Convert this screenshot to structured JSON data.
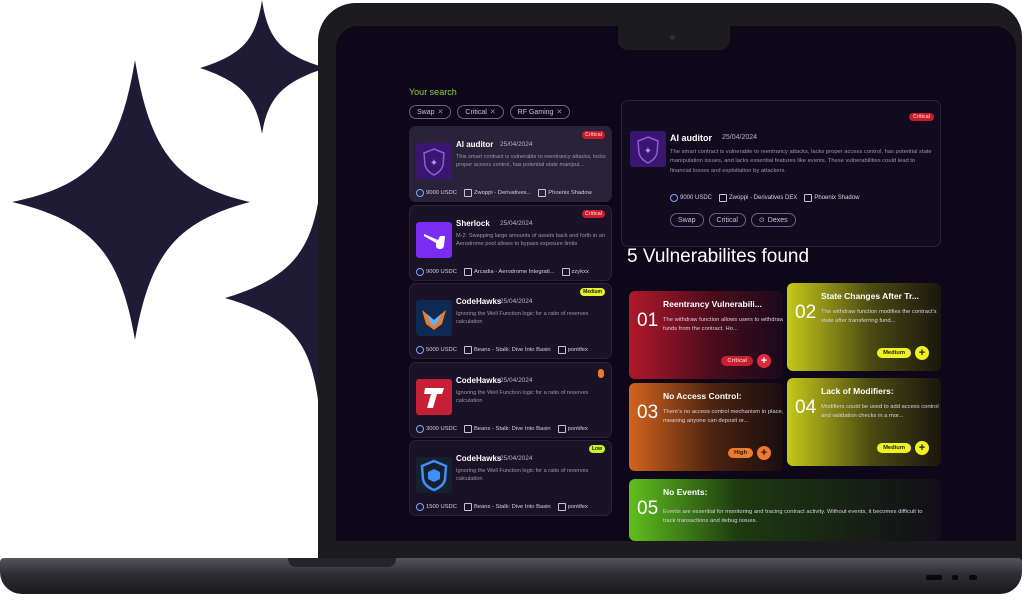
{
  "search": {
    "label": "Your search",
    "chips": [
      "Swap",
      "Critical",
      "RF Gaming"
    ]
  },
  "results": [
    {
      "title": "AI auditor",
      "date": "25/04/2024",
      "description": "This smart contract is vulnerable to reentrancy attacks, locks proper access control, has potential state manipul...",
      "amount": "9000 USDC",
      "project": "Zwoppi - Derivatives...",
      "auditor": "Phoenix Shadow",
      "badge": "Critical",
      "logo": "ai-auditor-logo"
    },
    {
      "title": "Sherlock",
      "date": "25/04/2024",
      "description": "M-2: Swapping large amounts of assets back and forth in an Aerodrome pool allows to bypass exposure limits",
      "amount": "9000 USDC",
      "project": "Arcadia - Aerodrome Integrati...",
      "auditor": "zzykxx",
      "badge": "Critical",
      "logo": "sherlock-pipe-logo"
    },
    {
      "title": "CodeHawks",
      "date": "25/04/2024",
      "description": "Ignoring the Well Function logic for a ratio of reserves calculation",
      "amount": "5000 USDC",
      "project": "Beans - Stalk: Dive Into Basin",
      "auditor": "pontifex",
      "badge": "Medium",
      "logo": "codehawks-logo"
    },
    {
      "title": "CodeHawks",
      "date": "25/04/2024",
      "description": "Ignoring the Well Function logic for a ratio of reserves calculation",
      "amount": "3000 USDC",
      "project": "Beans - Stalk: Dive Into Basin",
      "auditor": "pontifex",
      "badge": "",
      "logo": "t-letter-logo"
    },
    {
      "title": "CodeHawks",
      "date": "25/04/2024",
      "description": "Ignoring the Well Function logic for a ratio of reserves calculation",
      "amount": "1500 USDC",
      "project": "Beans - Stalk: Dive Into Basin",
      "auditor": "pontifex",
      "badge": "Low",
      "logo": "shield-cube-logo"
    }
  ],
  "detail": {
    "title": "AI auditor",
    "date": "25/04/2024",
    "badge": "Critical",
    "description": "The smart contract is vulnerable to reentrancy attacks, lacks proper access control, has potential state manipulation issues, and lacks essential features like events. These vulnerabilities could lead to financial losses and exploitation by attackers.",
    "amount": "9000 USDC",
    "project": "Zwoppi - Derivatives DEX",
    "auditor": "Phoenix Shadow",
    "tags": [
      "Swap",
      "Critical",
      "Dexes"
    ]
  },
  "vulnerabilities": {
    "heading": "5 Vulnerabilites found",
    "items": [
      {
        "number": "01",
        "title": "Reentrancy Vulnerabili...",
        "description": "The withdraw function allows users to withdraw funds from the contract. Ho...",
        "severity": "Critical"
      },
      {
        "number": "02",
        "title": "State Changes After Tr...",
        "description": "The withdraw function modifies the contract's state after transferring fund...",
        "severity": "Medium"
      },
      {
        "number": "03",
        "title": "No Access Control:",
        "description": "There's no access control mechanism in place, meaning anyone can deposit or...",
        "severity": "High"
      },
      {
        "number": "04",
        "title": "Lack of Modifiers:",
        "description": "Modifiers could be used to add access control and validation checks in a mor...",
        "severity": "Medium"
      },
      {
        "number": "05",
        "title": "No Events:",
        "description": "Events are essential for monitoring and tracing contract activity. Without events, it becomes difficult to track transactions and debug issues.",
        "severity": ""
      }
    ]
  },
  "colors": {
    "background": "#0e0719",
    "critical": "#c8202e",
    "medium": "#f0f222",
    "high": "#f07a2c",
    "low": "#c8f528",
    "accent_green": "#8ad23a"
  }
}
